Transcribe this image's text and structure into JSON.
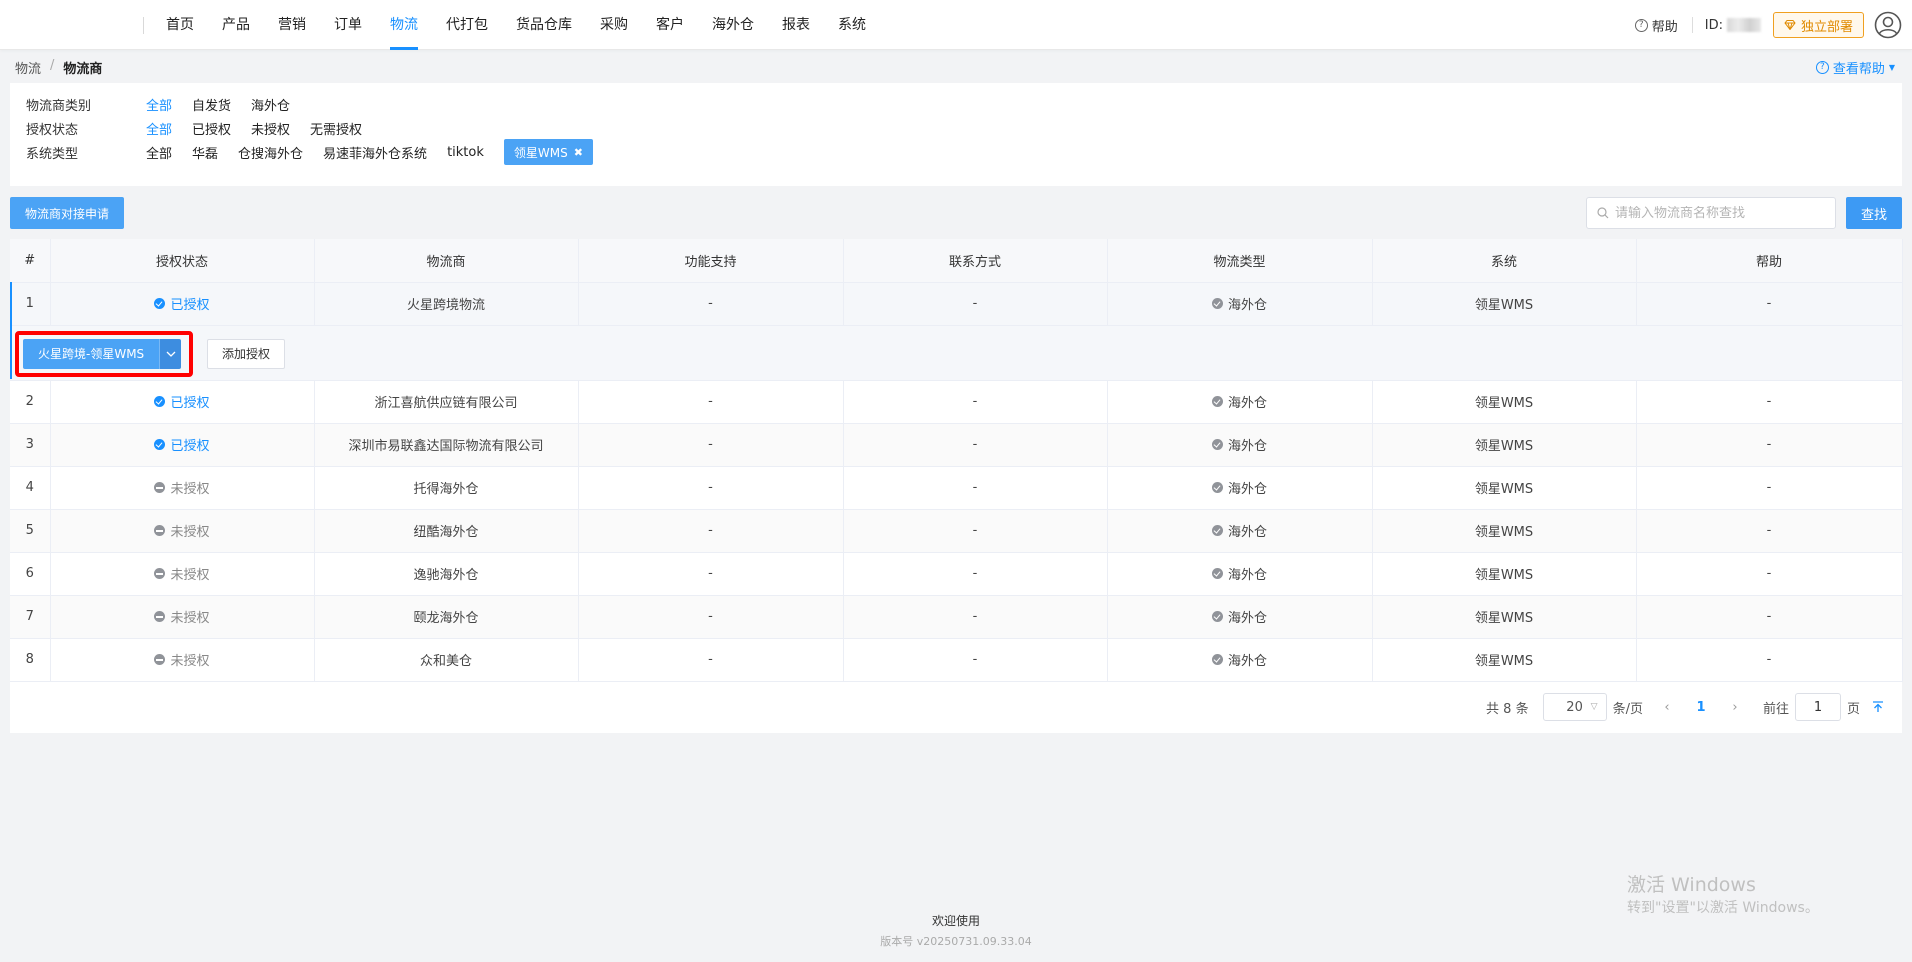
{
  "nav": {
    "items": [
      "首页",
      "产品",
      "营销",
      "订单",
      "物流",
      "代打包",
      "货品仓库",
      "采购",
      "客户",
      "海外仓",
      "报表",
      "系统"
    ],
    "active": "物流"
  },
  "header": {
    "help": "帮助",
    "id_label": "ID:",
    "deploy": "独立部署"
  },
  "breadcrumb": {
    "parent": "物流",
    "current": "物流商",
    "view_help": "查看帮助"
  },
  "filters": {
    "carrier_category": {
      "label": "物流商类别",
      "options": [
        "全部",
        "自发货",
        "海外仓"
      ],
      "selected": "全部"
    },
    "auth_status": {
      "label": "授权状态",
      "options": [
        "全部",
        "已授权",
        "未授权",
        "无需授权"
      ],
      "selected": "全部"
    },
    "system_type": {
      "label": "系统类型",
      "options": [
        "全部",
        "华磊",
        "仓搜海外仓",
        "易速菲海外仓系统",
        "tiktok"
      ],
      "active_tag": "领星WMS"
    }
  },
  "toolbar": {
    "apply_button": "物流商对接申请",
    "search_placeholder": "请输入物流商名称查找",
    "search_button": "查找"
  },
  "table": {
    "headers": [
      "#",
      "授权状态",
      "物流商",
      "功能支持",
      "联系方式",
      "物流类型",
      "系统",
      "帮助"
    ],
    "rows": [
      {
        "num": "1",
        "status": "已授权",
        "name": "火星跨境物流",
        "feature": "-",
        "contact": "-",
        "type": "海外仓",
        "system": "领星WMS",
        "help": "-"
      },
      {
        "num": "2",
        "status": "已授权",
        "name": "浙江喜航供应链有限公司",
        "feature": "-",
        "contact": "-",
        "type": "海外仓",
        "system": "领星WMS",
        "help": "-"
      },
      {
        "num": "3",
        "status": "已授权",
        "name": "深圳市易联鑫达国际物流有限公司",
        "feature": "-",
        "contact": "-",
        "type": "海外仓",
        "system": "领星WMS",
        "help": "-"
      },
      {
        "num": "4",
        "status": "未授权",
        "name": "托得海外仓",
        "feature": "-",
        "contact": "-",
        "type": "海外仓",
        "system": "领星WMS",
        "help": "-"
      },
      {
        "num": "5",
        "status": "未授权",
        "name": "纽酷海外仓",
        "feature": "-",
        "contact": "-",
        "type": "海外仓",
        "system": "领星WMS",
        "help": "-"
      },
      {
        "num": "6",
        "status": "未授权",
        "name": "逸驰海外仓",
        "feature": "-",
        "contact": "-",
        "type": "海外仓",
        "system": "领星WMS",
        "help": "-"
      },
      {
        "num": "7",
        "status": "未授权",
        "name": "颐龙海外仓",
        "feature": "-",
        "contact": "-",
        "type": "海外仓",
        "system": "领星WMS",
        "help": "-"
      },
      {
        "num": "8",
        "status": "未授权",
        "name": "众和美仓",
        "feature": "-",
        "contact": "-",
        "type": "海外仓",
        "system": "领星WMS",
        "help": "-"
      }
    ],
    "expanded": {
      "account_button": "火星跨境-领星WMS",
      "add_auth_button": "添加授权"
    }
  },
  "pagination": {
    "total": "共 8 条",
    "page_size": "20",
    "per_page": "条/页",
    "current_page": "1",
    "goto_label": "前往",
    "goto_value": "1",
    "page_unit": "页"
  },
  "footer": {
    "welcome": "欢迎使用",
    "version": "版本号 v20250731.09.33.04"
  },
  "watermark": {
    "line1": "激活 Windows",
    "line2": "转到\"设置\"以激活 Windows。"
  },
  "colors": {
    "accent": "#1890ff",
    "button": "#4ba3f5",
    "highlight": "#ff0000",
    "deploy": "#f0a020"
  }
}
